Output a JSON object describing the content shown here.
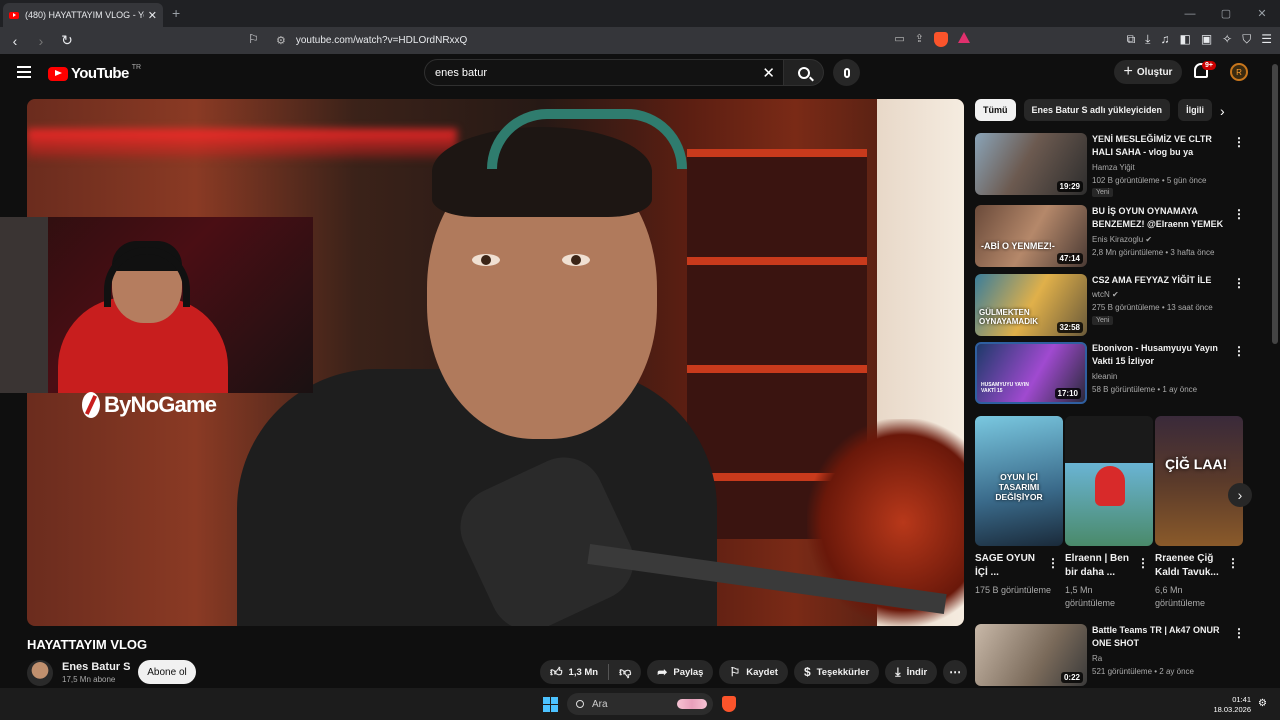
{
  "browser": {
    "tab_title": "(480) HAYATTAYIM VLOG - YouTu",
    "tab_close": "✕",
    "new_tab": "+",
    "url": "youtube.com/watch?v=HDLOrdNRxxQ",
    "window_min": "—",
    "window_max": "▢",
    "window_close": "✕"
  },
  "youtube": {
    "logo_text": "YouTube",
    "region": "TR",
    "search_value": "enes batur",
    "clear": "✕",
    "create_label": "Oluştur",
    "notif_badge": "9+"
  },
  "video": {
    "overlay_brand": "ByNoGame",
    "title": "HAYATTAYIM VLOG",
    "channel": "Enes Batur S",
    "subscribers": "17,5 Mn abone",
    "subscribe_label": "Abone ol",
    "likes": "1,3 Mn",
    "share_label": "Paylaş",
    "save_label": "Kaydet",
    "thanks_label": "Teşekkürler",
    "download_label": "İndir"
  },
  "chips": [
    "Tümü",
    "Enes Batur S adlı yükleyiciden",
    "İlgili"
  ],
  "recommendations": [
    {
      "title": "YENİ MESLEĞİMİZ VE CLTR HALI SAHA - vlog bu ya",
      "channel": "Hamza Yiğit",
      "meta": "102 B görüntüleme • 5 gün önce",
      "duration": "19:29",
      "badge": "Yeni"
    },
    {
      "title": "BU İŞ OYUN OYNAMAYA BENZEMEZ! @Elraenn YEMEK ...",
      "channel": "Enis Kirazoglu ✔",
      "meta": "2,8 Mn görüntüleme • 3 hafta önce",
      "duration": "47:14",
      "badge": ""
    },
    {
      "title": "CS2 AMA FEYYAZ YİĞİT İLE",
      "channel": "wtcN ✔",
      "meta": "275 B görüntüleme • 13 saat önce",
      "duration": "32:58",
      "badge": "Yeni"
    },
    {
      "title": "Ebonivon - Husamyuyu Yayın Vakti 15 İzliyor",
      "channel": "kleanin",
      "meta": "58 B görüntüleme • 1 ay önce",
      "duration": "17:10",
      "badge": ""
    }
  ],
  "thumb_texts": [
    "-ABİ O YENMEZ!-",
    "GÜLMEKTEN OYNAYAMADIK",
    "HUSAMYUYU YAYIN VAKTİ 15"
  ],
  "shorts": [
    {
      "title": "SAGE OYUN İÇİ ...",
      "views": "175 B görüntüleme",
      "overlay": "OYUN İÇİ TASARIMI DEĞİŞİYOR"
    },
    {
      "title": "Elraenn | Ben bir daha ...",
      "views": "1,5 Mn görüntüleme",
      "overlay": ""
    },
    {
      "title": "Rraenee Çiğ Kaldı Tavuk...",
      "views": "6,6 Mn görüntüleme",
      "overlay": "ÇİĞ LAA!"
    }
  ],
  "rec5": {
    "title": "Battle Teams TR | Ak47 ONUR ONE SHOT",
    "channel": "Ra",
    "meta": "521 görüntüleme • 2 ay önce",
    "duration": "0:22"
  },
  "taskbar": {
    "search_placeholder": "Ara",
    "time": "01:41",
    "date": "18.03.2026"
  },
  "colors": {
    "accent_red": "#ff0000",
    "brave_orange": "#fb542b",
    "windows_blue": "#4cc2ff"
  }
}
